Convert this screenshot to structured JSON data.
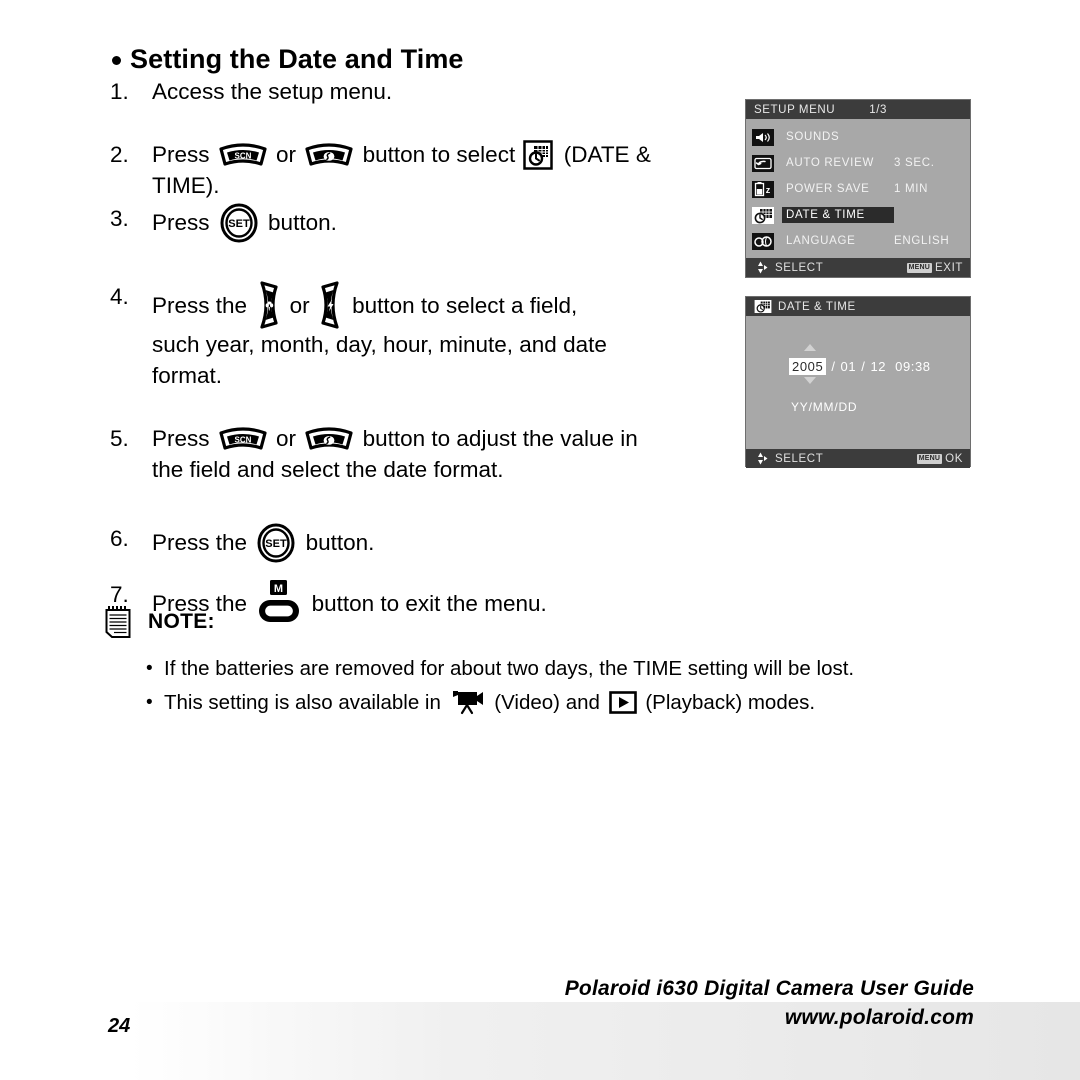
{
  "heading": "Setting the Date and Time",
  "steps": {
    "s1_num": "1.",
    "s1_text": "Access the setup menu.",
    "s2_num": "2.",
    "s2_press": "Press",
    "s2_or": "or",
    "s2_mid": "button to select",
    "s2_tail": "(DATE &",
    "s2_line2": "TIME).",
    "s3_num": "3.",
    "s3_press": "Press",
    "s3_tail": "button.",
    "s4_num": "4.",
    "s4_press": "Press the",
    "s4_or": "or",
    "s4_mid": "button to select a field,",
    "s4_line2": "such year, month, day, hour, minute, and date",
    "s4_line3": "format.",
    "s5_num": "5.",
    "s5_press": "Press",
    "s5_or": "or",
    "s5_mid": "button to adjust the value in",
    "s5_line2": "the field and select the date format.",
    "s6_num": "6.",
    "s6_press": "Press  the",
    "s6_tail": "button.",
    "s7_num": "7.",
    "s7_press": "Press the",
    "s7_tail": "button to exit the menu."
  },
  "note": {
    "title": "NOTE:",
    "bullet_glyph": "•",
    "item1": "If the batteries are removed for about two days, the TIME setting will be lost.",
    "item2_pre": "This setting is also available in",
    "item2_video": "(Video) and",
    "item2_play": "(Playback) modes."
  },
  "setup_menu": {
    "title": "SETUP MENU",
    "page": "1/3",
    "rows": [
      {
        "icon": "speaker-icon",
        "label": "SOUNDS",
        "value": ""
      },
      {
        "icon": "auto-review-icon",
        "label": "AUTO REVIEW",
        "value": "3 SEC."
      },
      {
        "icon": "power-save-icon",
        "label": "POWER SAVE",
        "value": "1 MIN"
      },
      {
        "icon": "date-time-icon",
        "label": "DATE & TIME",
        "value": ""
      },
      {
        "icon": "language-icon",
        "label": "LANGUAGE",
        "value": "ENGLISH"
      }
    ],
    "selected_index": 3,
    "footer_select": "SELECT",
    "footer_badge": "MENU",
    "footer_action": "EXIT"
  },
  "datetime_panel": {
    "title": "DATE & TIME",
    "year": "2005",
    "sep1": "/",
    "month": "01",
    "sep2": "/",
    "day": "12",
    "time": "09:38",
    "format": "YY/MM/DD",
    "footer_select": "SELECT",
    "footer_badge": "MENU",
    "footer_action": "OK"
  },
  "footer": {
    "page_number": "24",
    "guide_line": "Polaroid i630 Digital Camera User Guide",
    "website": "www.polaroid.com"
  },
  "colors": {
    "lcd_bg": "#a8a8a8",
    "lcd_bar": "#3c3c3c",
    "lcd_selected": "#2b2b2b",
    "text": "#000000"
  }
}
